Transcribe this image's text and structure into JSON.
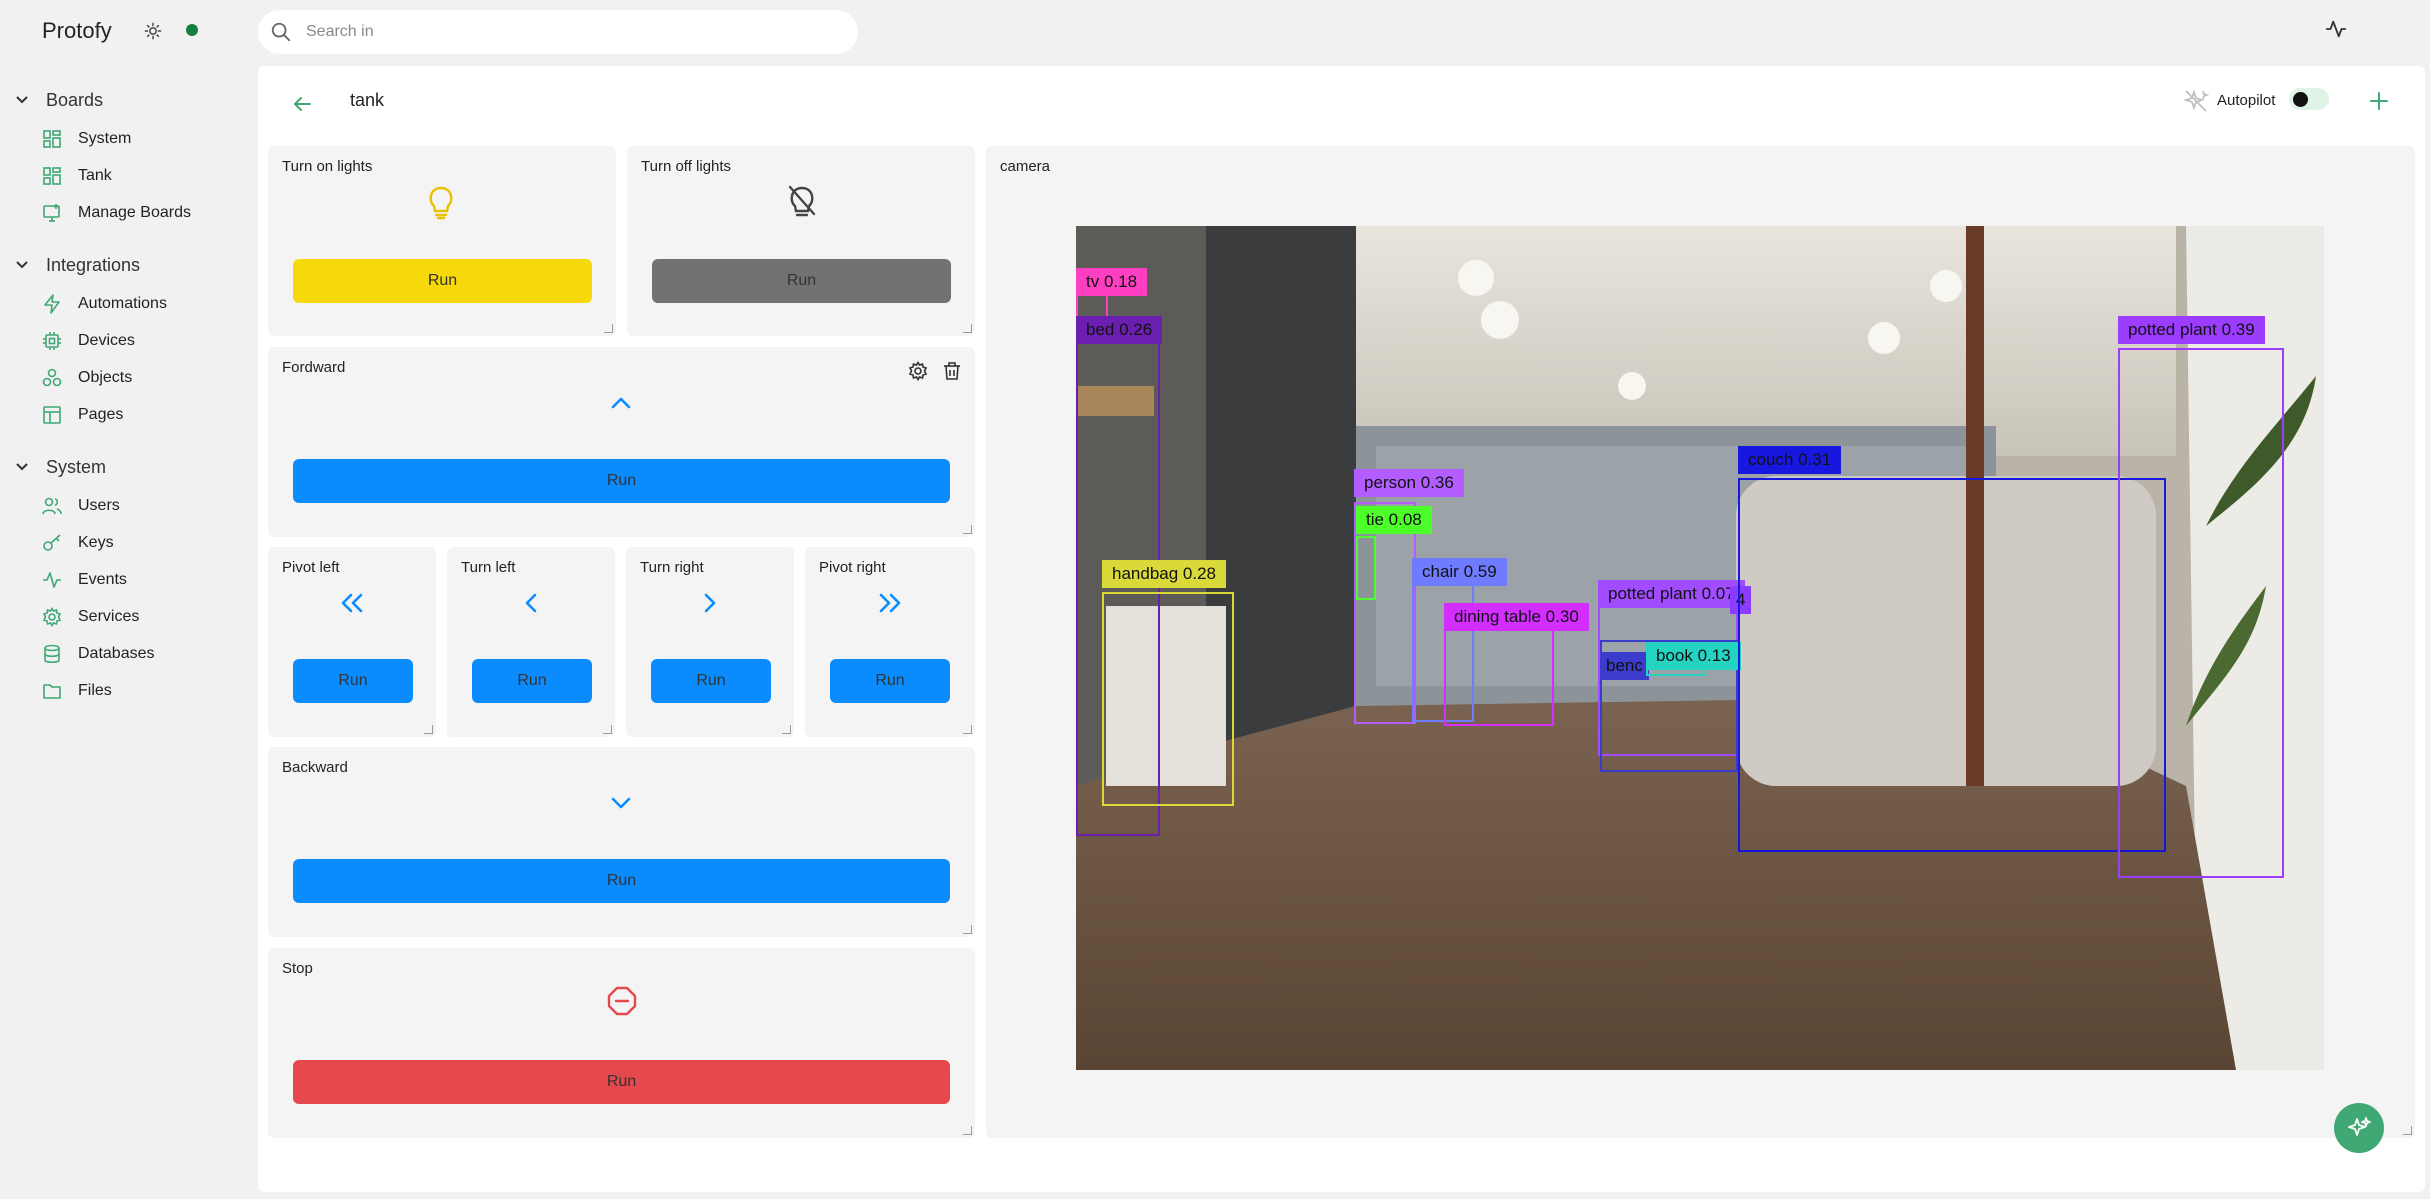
{
  "app": {
    "name": "Protofy"
  },
  "search": {
    "placeholder": "Search in"
  },
  "sidebar": {
    "sections": [
      {
        "label": "Boards",
        "items": [
          {
            "label": "System",
            "icon": "grid-icon"
          },
          {
            "label": "Tank",
            "icon": "grid-icon"
          },
          {
            "label": "Manage Boards",
            "icon": "monitor-plus-icon"
          }
        ]
      },
      {
        "label": "Integrations",
        "items": [
          {
            "label": "Automations",
            "icon": "bolt-icon"
          },
          {
            "label": "Devices",
            "icon": "cpu-icon"
          },
          {
            "label": "Objects",
            "icon": "boxes-icon"
          },
          {
            "label": "Pages",
            "icon": "layout-icon"
          }
        ]
      },
      {
        "label": "System",
        "items": [
          {
            "label": "Users",
            "icon": "users-icon"
          },
          {
            "label": "Keys",
            "icon": "key-icon"
          },
          {
            "label": "Events",
            "icon": "activity-icon"
          },
          {
            "label": "Services",
            "icon": "gear-icon"
          },
          {
            "label": "Databases",
            "icon": "database-icon"
          },
          {
            "label": "Files",
            "icon": "folder-icon"
          }
        ]
      }
    ]
  },
  "board": {
    "title": "tank",
    "autopilot_label": "Autopilot",
    "autopilot_on": false
  },
  "cards": {
    "turn_on_lights": {
      "title": "Turn on lights",
      "button": "Run"
    },
    "turn_off_lights": {
      "title": "Turn off lights",
      "button": "Run"
    },
    "forward": {
      "title": "Fordward",
      "button": "Run"
    },
    "pivot_left": {
      "title": "Pivot left",
      "button": "Run"
    },
    "turn_left": {
      "title": "Turn left",
      "button": "Run"
    },
    "turn_right": {
      "title": "Turn right",
      "button": "Run"
    },
    "pivot_right": {
      "title": "Pivot right",
      "button": "Run"
    },
    "backward": {
      "title": "Backward",
      "button": "Run"
    },
    "stop": {
      "title": "Stop",
      "button": "Run"
    },
    "camera": {
      "title": "camera"
    }
  },
  "detections": [
    {
      "label": "tv 0.18",
      "color": "#ff3fc1"
    },
    {
      "label": "bed 0.26",
      "color": "#6a1fb0"
    },
    {
      "label": "handbag 0.28",
      "color": "#d9d93a"
    },
    {
      "label": "person 0.36",
      "color": "#b35cff"
    },
    {
      "label": "tie 0.08",
      "color": "#4cff2a"
    },
    {
      "label": "chair 0.59",
      "color": "#6f7cff"
    },
    {
      "label": "dining table 0.30",
      "color": "#d32dff"
    },
    {
      "label": "potted plant 0.07",
      "color": "#a14dff"
    },
    {
      "label": "4",
      "color": "#8a3dff"
    },
    {
      "label": "benc",
      "color": "#3b3bcc"
    },
    {
      "label": "book 0.13",
      "color": "#25d4c0"
    },
    {
      "label": "couch 0.31",
      "color": "#1717e0"
    },
    {
      "label": "potted plant 0.39",
      "color": "#9b3cff"
    }
  ],
  "colors": {
    "accent": "#3fa874",
    "blue_button": "#0a8cff",
    "yellow_button": "#f6d90a",
    "gray_button": "#727272",
    "red_button": "#e5484d"
  }
}
